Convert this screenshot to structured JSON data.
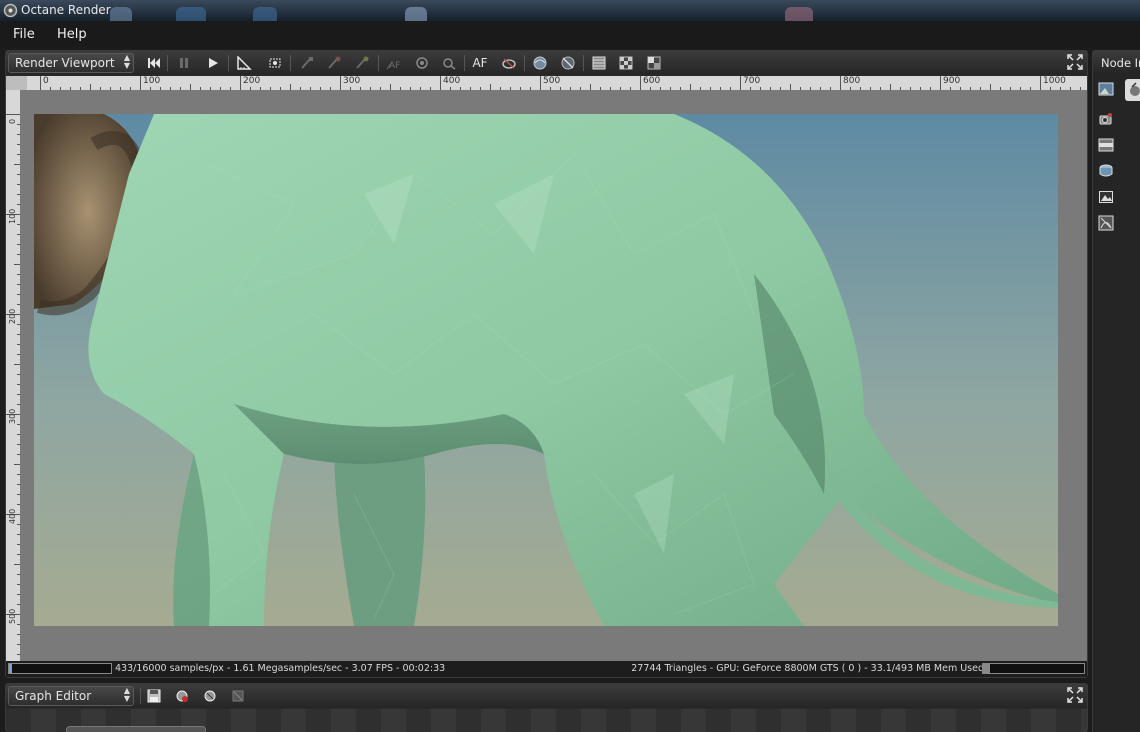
{
  "window": {
    "title": "Octane Render"
  },
  "menu": {
    "items": [
      "File",
      "Help"
    ]
  },
  "render_viewport": {
    "panel_label": "Render Viewport",
    "toolbar": {
      "text_buttons": {
        "autofocus": "AF"
      },
      "icons": [
        "restart-icon",
        "pause-icon",
        "play-icon",
        "measure-icon",
        "zoom-fit-icon",
        "pick-focus-icon",
        "pick-material-icon",
        "pick-object-icon",
        "autofocus-icon",
        "white-balance-icon",
        "pick-white-icon",
        "region-render-icon",
        "lock-region-icon",
        "clay-mode-icon",
        "background-icon",
        "checker-bg-icon",
        "alpha-bg-icon",
        "maximize-icon"
      ]
    },
    "ruler": {
      "top_labels": [
        "0",
        "100",
        "200",
        "300",
        "400",
        "500",
        "600",
        "700",
        "800",
        "900",
        "1000"
      ],
      "left_labels": [
        "0",
        "100",
        "200",
        "300",
        "400",
        "500"
      ]
    },
    "status": {
      "left": "433/16000 samples/px - 1.61 Megasamples/sec - 3.07 FPS - 00:02:33",
      "right": "27744 Triangles - GPU: GeForce 8800M GTS ( 0 ) - 33.1/493 MB Mem Used",
      "render_progress": 0.03,
      "memory_used": 0.067
    }
  },
  "node_inspector": {
    "title": "Node Ins",
    "icons": [
      "preview-image-icon",
      "material-icon",
      "camera-settings-icon",
      "film-settings-icon",
      "render-target-icon",
      "environment-icon",
      "imager-icon"
    ]
  },
  "graph_editor": {
    "panel_label": "Graph Editor",
    "icons": [
      "save-icon",
      "load-icon",
      "refresh-icon",
      "delete-icon",
      "maximize-icon"
    ]
  },
  "colors": {
    "sky_top": "#5e8aa3",
    "sky_bottom": "#a5ab91",
    "creature": "#8ec9a3",
    "canvas_bg": "#7a7a7a",
    "ruler_bg": "#d8d8d8"
  }
}
